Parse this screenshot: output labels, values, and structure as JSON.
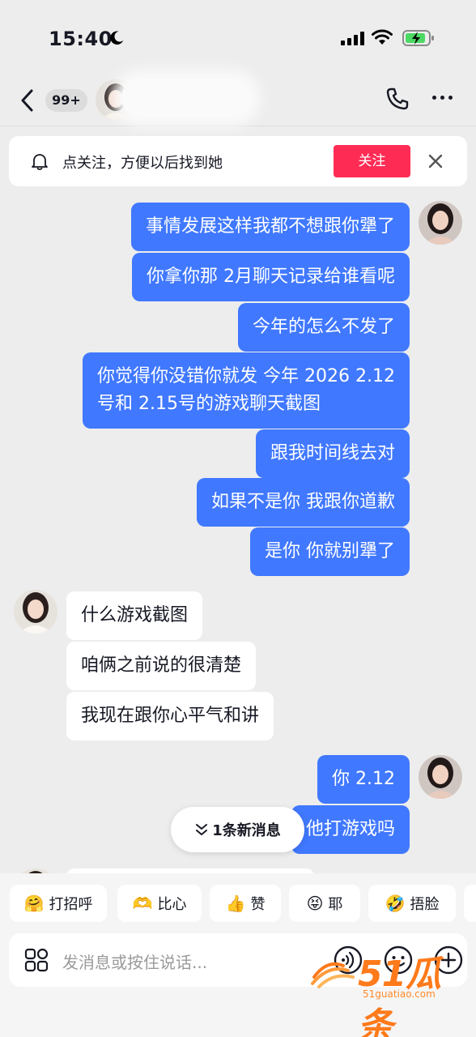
{
  "status_bar": {
    "time": "15:40"
  },
  "header": {
    "unread_count": "99+"
  },
  "follow_banner": {
    "text": "点关注，方便以后找到她",
    "button_label": "关注"
  },
  "messages": [
    {
      "side": "me",
      "text": "事情发展这样我都不想跟你犟了"
    },
    {
      "side": "me",
      "text": "你拿你那 2月聊天记录给谁看呢"
    },
    {
      "side": "me",
      "text": "今年的怎么不发了"
    },
    {
      "side": "me",
      "text": "你觉得你没错你就发 今年 2026 2.12\n号和 2.15号的游戏聊天截图"
    },
    {
      "side": "me",
      "text": "跟我时间线去对"
    },
    {
      "side": "me",
      "text": "如果不是你 我跟你道歉"
    },
    {
      "side": "me",
      "text": "是你 你就别犟了"
    },
    {
      "side": "them",
      "text": "什么游戏截图"
    },
    {
      "side": "them",
      "text": "咱俩之前说的很清楚"
    },
    {
      "side": "them",
      "text": "我现在跟你心平气和讲"
    },
    {
      "side": "me",
      "text": "你 2.12"
    },
    {
      "side": "me",
      "text": "他打游戏吗"
    }
  ],
  "new_message_pill": {
    "label": "1条新消息"
  },
  "quick_replies": [
    {
      "label": "打招呼",
      "emoji": "🤗",
      "icon": "hug-emoji-icon"
    },
    {
      "label": "比心",
      "emoji": "🫶",
      "icon": "heart-hands-emoji-icon"
    },
    {
      "label": "赞",
      "emoji": "👍",
      "icon": "thumbs-up-emoji-icon"
    },
    {
      "label": "耶",
      "emoji": "😝",
      "icon": "tongue-out-emoji-icon"
    },
    {
      "label": "捂脸",
      "emoji": "🤣",
      "icon": "facepalm-emoji-icon"
    }
  ],
  "input": {
    "placeholder": "发消息或按住说话..."
  },
  "watermark": {
    "logo_text": "51瓜条",
    "url": "51guatiao.com"
  },
  "colors": {
    "accent_red": "#fe2c55",
    "my_bubble": "#4078ff",
    "background": "#ededed",
    "watermark_orange": "#ff7a1a"
  }
}
